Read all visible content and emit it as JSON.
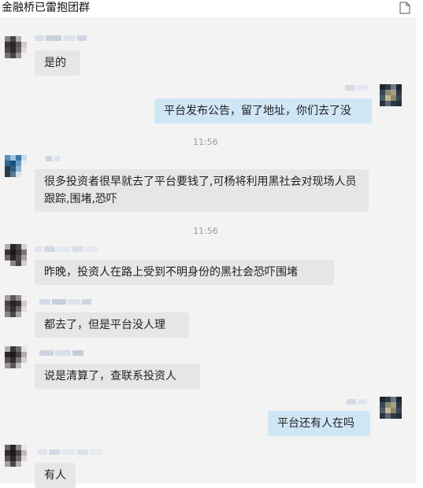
{
  "header": {
    "title": "金融桥已雷抱团群",
    "icon": "document-icon"
  },
  "messages": [
    {
      "side": "in",
      "text": "是的"
    },
    {
      "side": "out",
      "text": "平台发布公告，留了地址，你们去了没"
    },
    {
      "type": "time",
      "text": "11:56"
    },
    {
      "side": "in",
      "text": "很多投资者很早就去了平台要钱了,可杨将利用黑社会对现场人员跟踪,围堵,恐吓"
    },
    {
      "type": "time",
      "text": "11:56"
    },
    {
      "side": "in",
      "text": "昨晚，投资人在路上受到不明身份的黑社会恐吓围堵"
    },
    {
      "side": "in",
      "text": "都去了，但是平台没人理"
    },
    {
      "side": "in",
      "text": "说是清算了，查联系投资人"
    },
    {
      "side": "out",
      "text": "平台还有人在吗"
    },
    {
      "side": "in",
      "text": "有人"
    }
  ],
  "colors": {
    "incoming_bubble": "#e6e6e6",
    "outgoing_bubble": "#cfe6f5",
    "chat_background": "#f3f3f3",
    "timestamp": "#9a9a9a"
  }
}
